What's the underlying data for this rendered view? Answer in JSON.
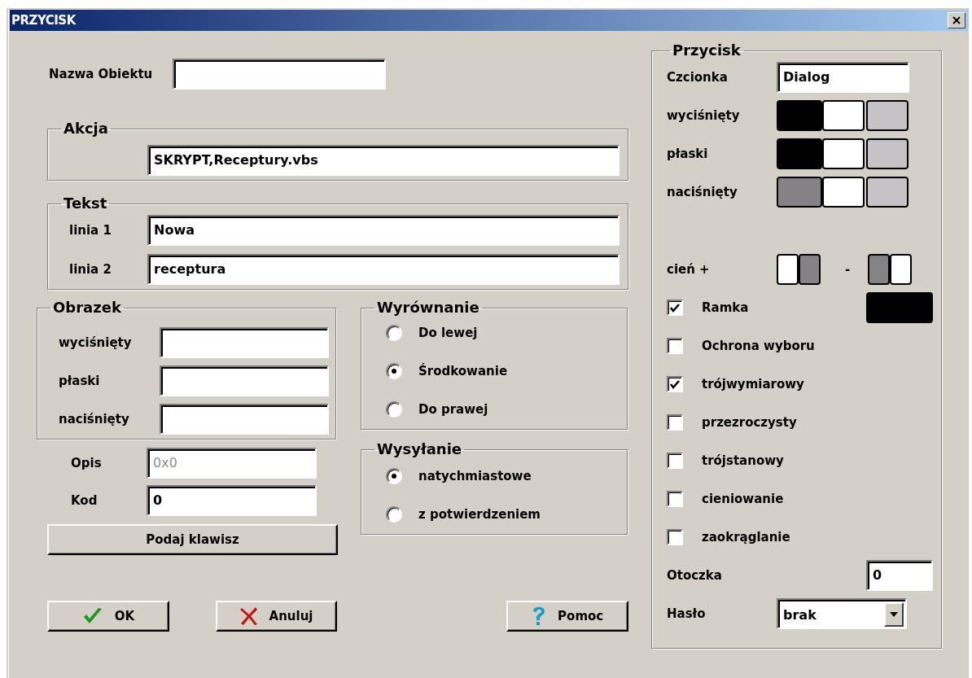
{
  "window": {
    "title": "PRZYCISK"
  },
  "object_name": {
    "label": "Nazwa Obiektu"
  },
  "action": {
    "title": "Akcja",
    "value": "SKRYPT,Receptury.vbs"
  },
  "text": {
    "title": "Tekst",
    "lines": [
      {
        "label": "linia 1",
        "value": "Nowa"
      },
      {
        "label": "linia 2",
        "value": "receptura"
      }
    ]
  },
  "image": {
    "title": "Obrazek",
    "fields": [
      {
        "label": "wyciśnięty"
      },
      {
        "label": "płaski"
      },
      {
        "label": "naciśnięty"
      }
    ]
  },
  "description": {
    "label": "Opis",
    "value": "0x0",
    "disabled": true
  },
  "code": {
    "label": "Kod",
    "value": "0"
  },
  "key_button": {
    "label": "Podaj klawisz"
  },
  "alignment": {
    "title": "Wyrównanie",
    "options": [
      {
        "label": "Do lewej",
        "selected": false
      },
      {
        "label": "Środkowanie",
        "selected": true
      },
      {
        "label": "Do prawej",
        "selected": false
      }
    ]
  },
  "sending": {
    "title": "Wysyłanie",
    "options": [
      {
        "label": "natychmiastowe",
        "selected": true
      },
      {
        "label": "z potwierdzeniem",
        "selected": false
      }
    ]
  },
  "button_panel": {
    "title": "Przycisk",
    "font": {
      "label": "Czcionka",
      "value": "Dialog"
    },
    "states": [
      {
        "label": "wyciśnięty",
        "swatches": [
          {
            "color": "#000000"
          },
          {
            "color": "#ffffff"
          },
          {
            "color": "#c6c3c6"
          }
        ]
      },
      {
        "label": "płaski",
        "swatches": [
          {
            "color": "#000000"
          },
          {
            "color": "#ffffff"
          },
          {
            "color": "#c6c3c6"
          }
        ]
      },
      {
        "label": "naciśnięty",
        "swatches": [
          {
            "color": "#848284"
          },
          {
            "color": "#ffffff"
          },
          {
            "color": "#c6c3c6"
          }
        ]
      }
    ],
    "shadow": {
      "label": "cień +",
      "plus": [
        {
          "color": "#ffffff"
        },
        {
          "color": "#848284"
        }
      ],
      "minus_label": "-",
      "minus": [
        {
          "color": "#848284"
        },
        {
          "color": "#ffffff"
        }
      ]
    },
    "checks": [
      {
        "label": "Ramka",
        "checked": true,
        "color": "#000000"
      },
      {
        "label": "Ochrona wyboru",
        "checked": false
      },
      {
        "label": "trójwymiarowy",
        "checked": true
      },
      {
        "label": "przezroczysty",
        "checked": false
      },
      {
        "label": "trójstanowy",
        "checked": false
      },
      {
        "label": "cieniowanie",
        "checked": false
      },
      {
        "label": "zaokrąglanie",
        "checked": false
      }
    ],
    "border_width": {
      "label": "Otoczka",
      "value": "0"
    },
    "password": {
      "label": "Hasło",
      "value": "brak"
    }
  },
  "buttons": [
    {
      "kind": "ok",
      "label": "OK"
    },
    {
      "kind": "cancel",
      "label": "Anuluj"
    },
    {
      "kind": "help",
      "label": "Pomoc"
    }
  ]
}
